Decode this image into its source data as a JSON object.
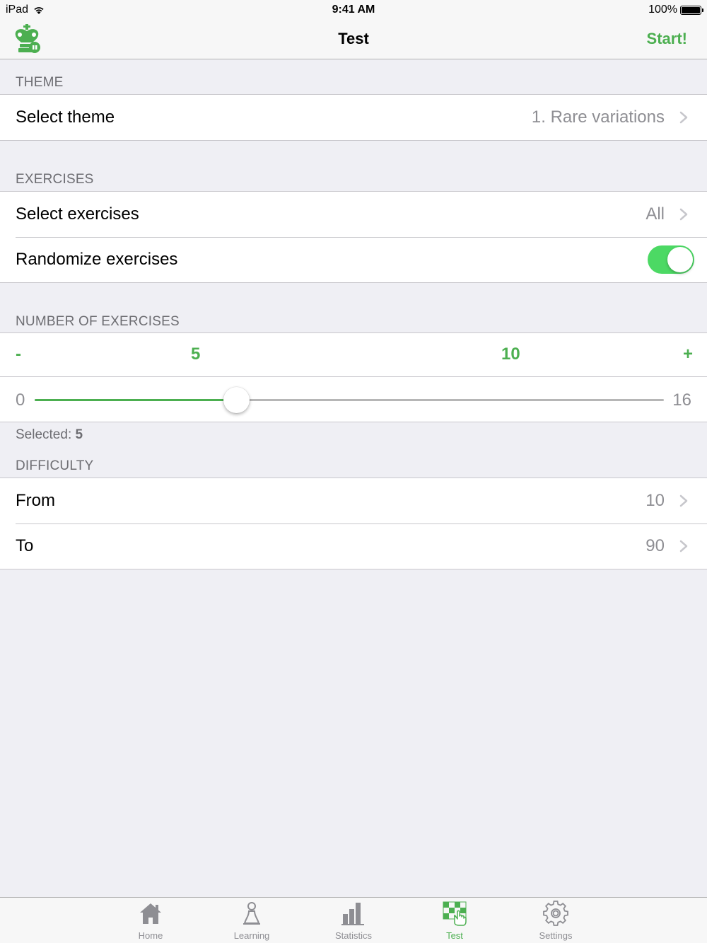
{
  "status_bar": {
    "device": "iPad",
    "time": "9:41 AM",
    "battery": "100%"
  },
  "nav": {
    "title": "Test",
    "start_label": "Start!"
  },
  "theme_section": {
    "header": "THEME",
    "select_theme_label": "Select theme",
    "select_theme_value": "1. Rare variations"
  },
  "exercises_section": {
    "header": "EXERCISES",
    "select_exercises_label": "Select exercises",
    "select_exercises_value": "All",
    "randomize_label": "Randomize exercises",
    "randomize_on": true
  },
  "number_section": {
    "header": "NUMBER OF EXERCISES",
    "minus_label": "-",
    "preset_a": "5",
    "preset_b": "10",
    "plus_label": "+",
    "slider_min": "0",
    "slider_max": "16",
    "slider_value": 5,
    "selected_label": "Selected:",
    "selected_value": "5"
  },
  "difficulty_section": {
    "header": "DIFFICULTY",
    "from_label": "From",
    "from_value": "10",
    "to_label": "To",
    "to_value": "90"
  },
  "tabs": [
    {
      "label": "Home",
      "icon": "home-icon"
    },
    {
      "label": "Learning",
      "icon": "pawn-icon"
    },
    {
      "label": "Statistics",
      "icon": "bar-chart-icon"
    },
    {
      "label": "Test",
      "icon": "checkerboard-hand-icon"
    },
    {
      "label": "Settings",
      "icon": "gear-icon"
    }
  ],
  "colors": {
    "accent": "#4caf50",
    "toggle_on": "#4cd964",
    "secondary_text": "#8e8e93"
  }
}
